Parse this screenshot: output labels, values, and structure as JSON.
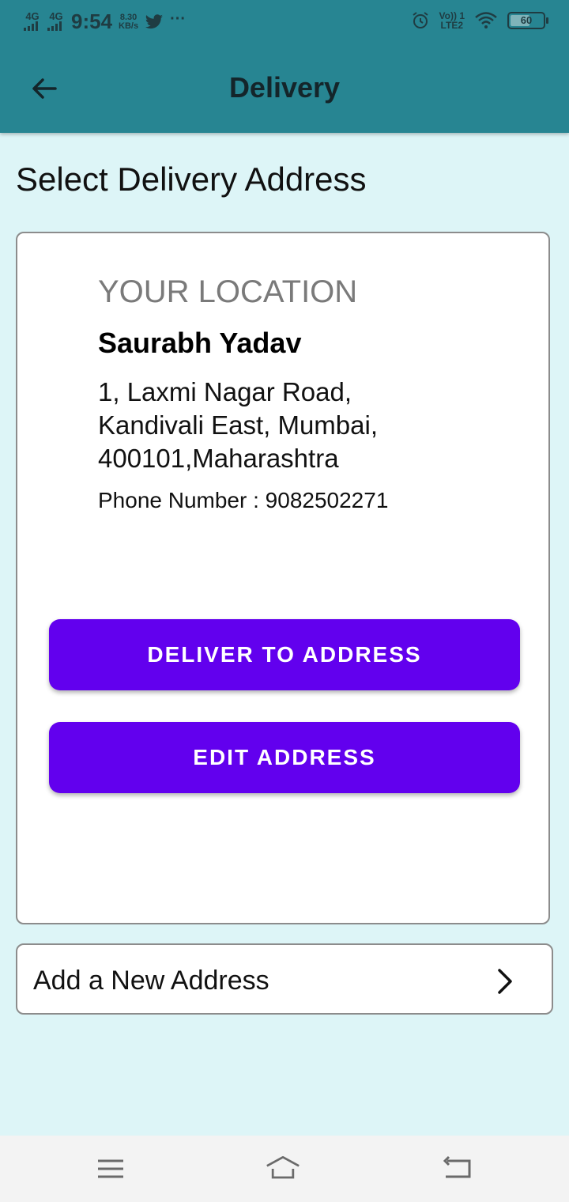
{
  "status_bar": {
    "signal1": "4G",
    "signal2": "4G",
    "time": "9:54",
    "speed_value": "8.30",
    "speed_unit": "KB/s",
    "volte_label": "Vo)) 1",
    "lte_label": "LTE2",
    "battery": "60",
    "battery_level": 0.6,
    "overflow": "···"
  },
  "appbar": {
    "title": "Delivery",
    "back_icon": "arrow-left-icon"
  },
  "page": {
    "section_title": "Select Delivery Address"
  },
  "address_card": {
    "location_label": "YOUR LOCATION",
    "name": "Saurabh Yadav",
    "address_line1": "1, Laxmi Nagar Road,",
    "address_line2": "Kandivali East, Mumbai,",
    "address_line3": "400101,Maharashtra",
    "phone": "Phone Number : 9082502271",
    "deliver_button": "DELIVER TO ADDRESS",
    "edit_button": "EDIT ADDRESS"
  },
  "add_address": {
    "label": "Add a New Address",
    "icon": "chevron-right-icon"
  },
  "navbar": {
    "menu_icon": "menu-icon",
    "home_icon": "home-icon",
    "back_icon": "back-icon"
  },
  "colors": {
    "appbar": "#278592",
    "background": "#ddf5f7",
    "button": "#6200ee"
  }
}
